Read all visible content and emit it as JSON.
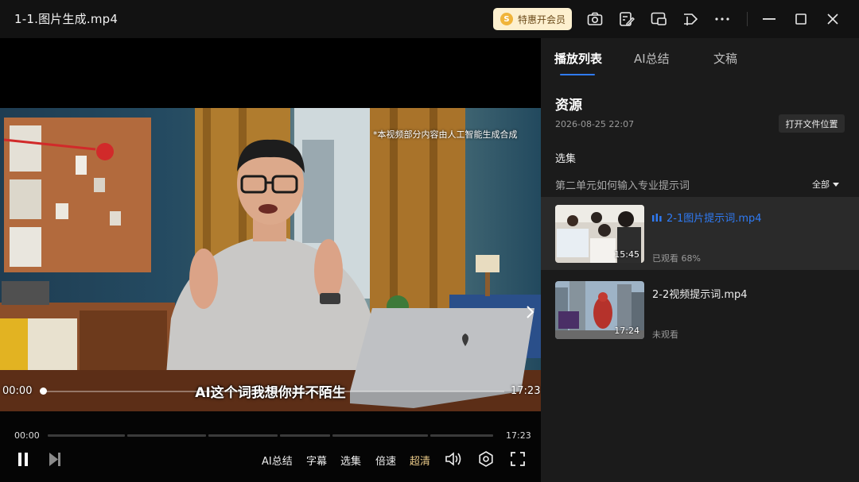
{
  "window": {
    "title": "1-1.图片生成.mp4",
    "vip_label": "特惠开会员",
    "vip_coin": "S"
  },
  "player": {
    "ai_notice": "*本视频部分内容由人工智能生成合成",
    "subtitle": "AI这个词我想你并不陌生",
    "overlay_time_current": "00:00",
    "overlay_time_total": "17:23",
    "time_current": "00:00",
    "time_total": "17:23",
    "progress": 0,
    "buttons": {
      "ai_summary": "AI总结",
      "captions": "字幕",
      "episodes": "选集",
      "speed": "倍速",
      "quality": "超清"
    },
    "quality_color": "#e8c887"
  },
  "sidebar": {
    "tabs": [
      {
        "label": "播放列表",
        "active": true
      },
      {
        "label": "AI总结",
        "active": false
      },
      {
        "label": "文稿",
        "active": false
      }
    ],
    "section_title": "资源",
    "section_date": "2026-08-25 22:07",
    "open_location": "打开文件位置",
    "collection_title": "选集",
    "unit_title": "第二单元如何输入专业提示词",
    "filter_label": "全部",
    "items": [
      {
        "name": "2-1图片提示词.mp4",
        "duration": "15:45",
        "status": "已观看 68%",
        "active": true
      },
      {
        "name": "2-2视频提示词.mp4",
        "duration": "17:24",
        "status": "未观看",
        "active": false
      }
    ],
    "accent_color": "#2f7bf5"
  }
}
